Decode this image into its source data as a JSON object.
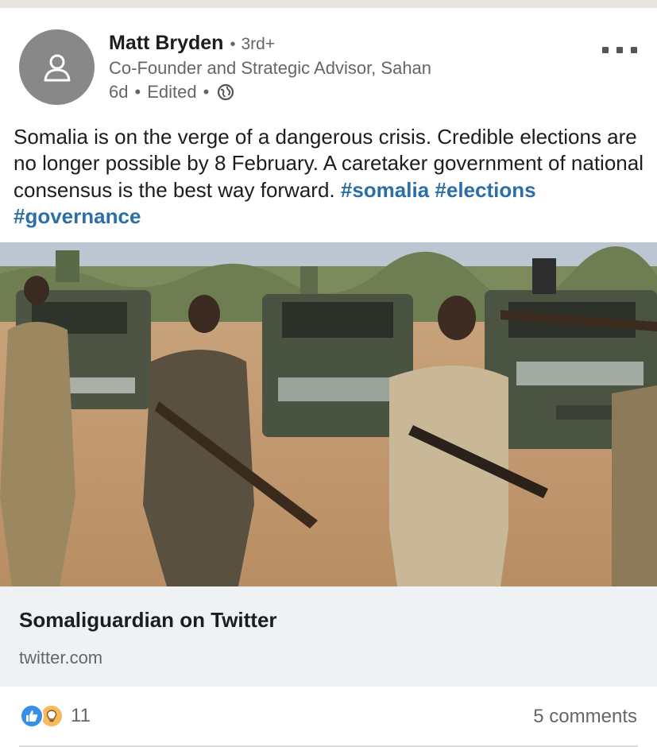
{
  "post": {
    "author": {
      "name": "Matt Bryden",
      "degree": "3rd+",
      "headline": "Co-Founder and Strategic Advisor, Sahan",
      "age": "6d",
      "edited": "Edited",
      "separator": "•",
      "visibility_icon": "globe-icon",
      "avatar_icon": "person-icon"
    },
    "menu_icon": "more-horizontal-icon",
    "text": "Somalia is on the verge of a dangerous crisis. Credible elections are no longer possible by 8 February. A caretaker government of national consensus is the best way forward.",
    "hashtags": [
      "#somalia",
      "#elections",
      "#governance"
    ]
  },
  "link_preview": {
    "title": "Somaliguardian on Twitter",
    "domain": "twitter.com"
  },
  "social": {
    "reaction_icons": [
      "like-icon",
      "insightful-icon"
    ],
    "reaction_count": "11",
    "comments_label": "5 comments"
  },
  "colors": {
    "hashtag": "#2c6fa8",
    "like": "#378fe9",
    "insightful": "#f5bb5c",
    "link_card_bg": "#eef2f5",
    "muted_text": "#666666"
  }
}
